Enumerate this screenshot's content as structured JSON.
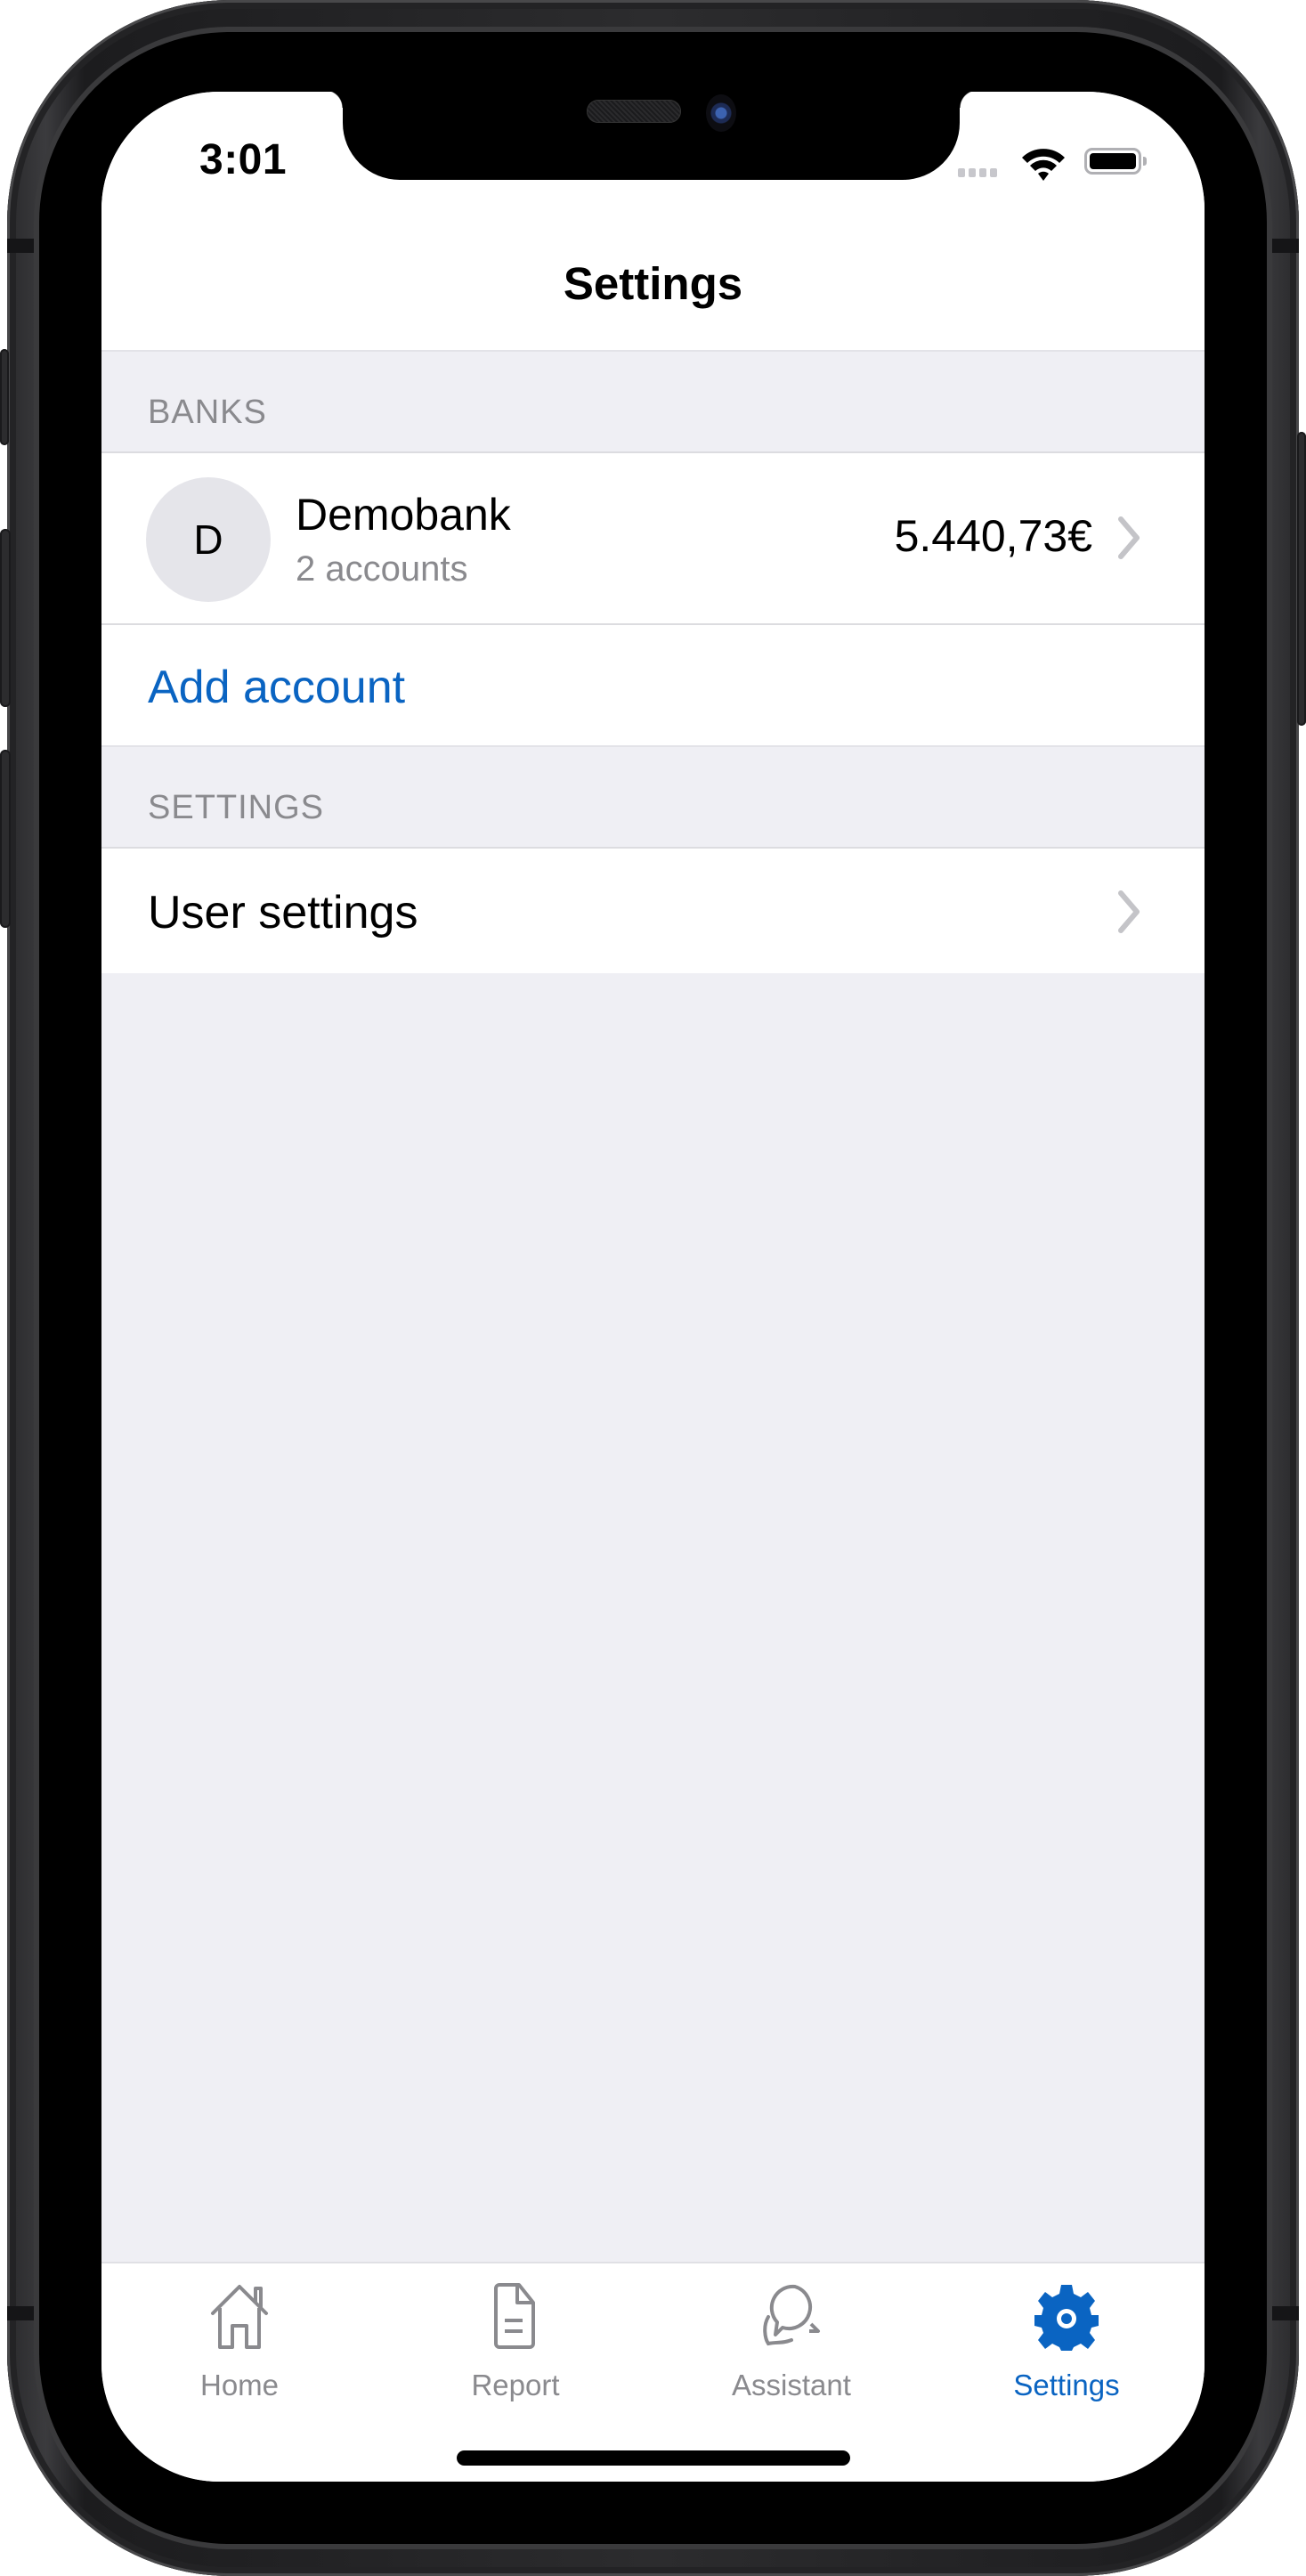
{
  "status_bar": {
    "time": "3:01",
    "icons": [
      "cellular-signal-icon",
      "wifi-icon",
      "battery-icon"
    ]
  },
  "nav": {
    "title": "Settings"
  },
  "sections": {
    "banks": {
      "header": "BANKS",
      "bank": {
        "avatar_letter": "D",
        "name": "Demobank",
        "subtitle": "2 accounts",
        "amount": "5.440,73€"
      },
      "add_account_label": "Add account"
    },
    "settings": {
      "header": "SETTINGS",
      "user_settings_label": "User settings"
    }
  },
  "tabbar": {
    "tabs": [
      {
        "label": "Home",
        "icon": "home-icon",
        "active": false
      },
      {
        "label": "Report",
        "icon": "document-icon",
        "active": false
      },
      {
        "label": "Assistant",
        "icon": "chat-bubbles-icon",
        "active": false
      },
      {
        "label": "Settings",
        "icon": "gear-icon",
        "active": true
      }
    ]
  },
  "colors": {
    "accent": "#0a64c2",
    "secondary_text": "#8a8a8e",
    "grouped_background": "#efeff4"
  }
}
